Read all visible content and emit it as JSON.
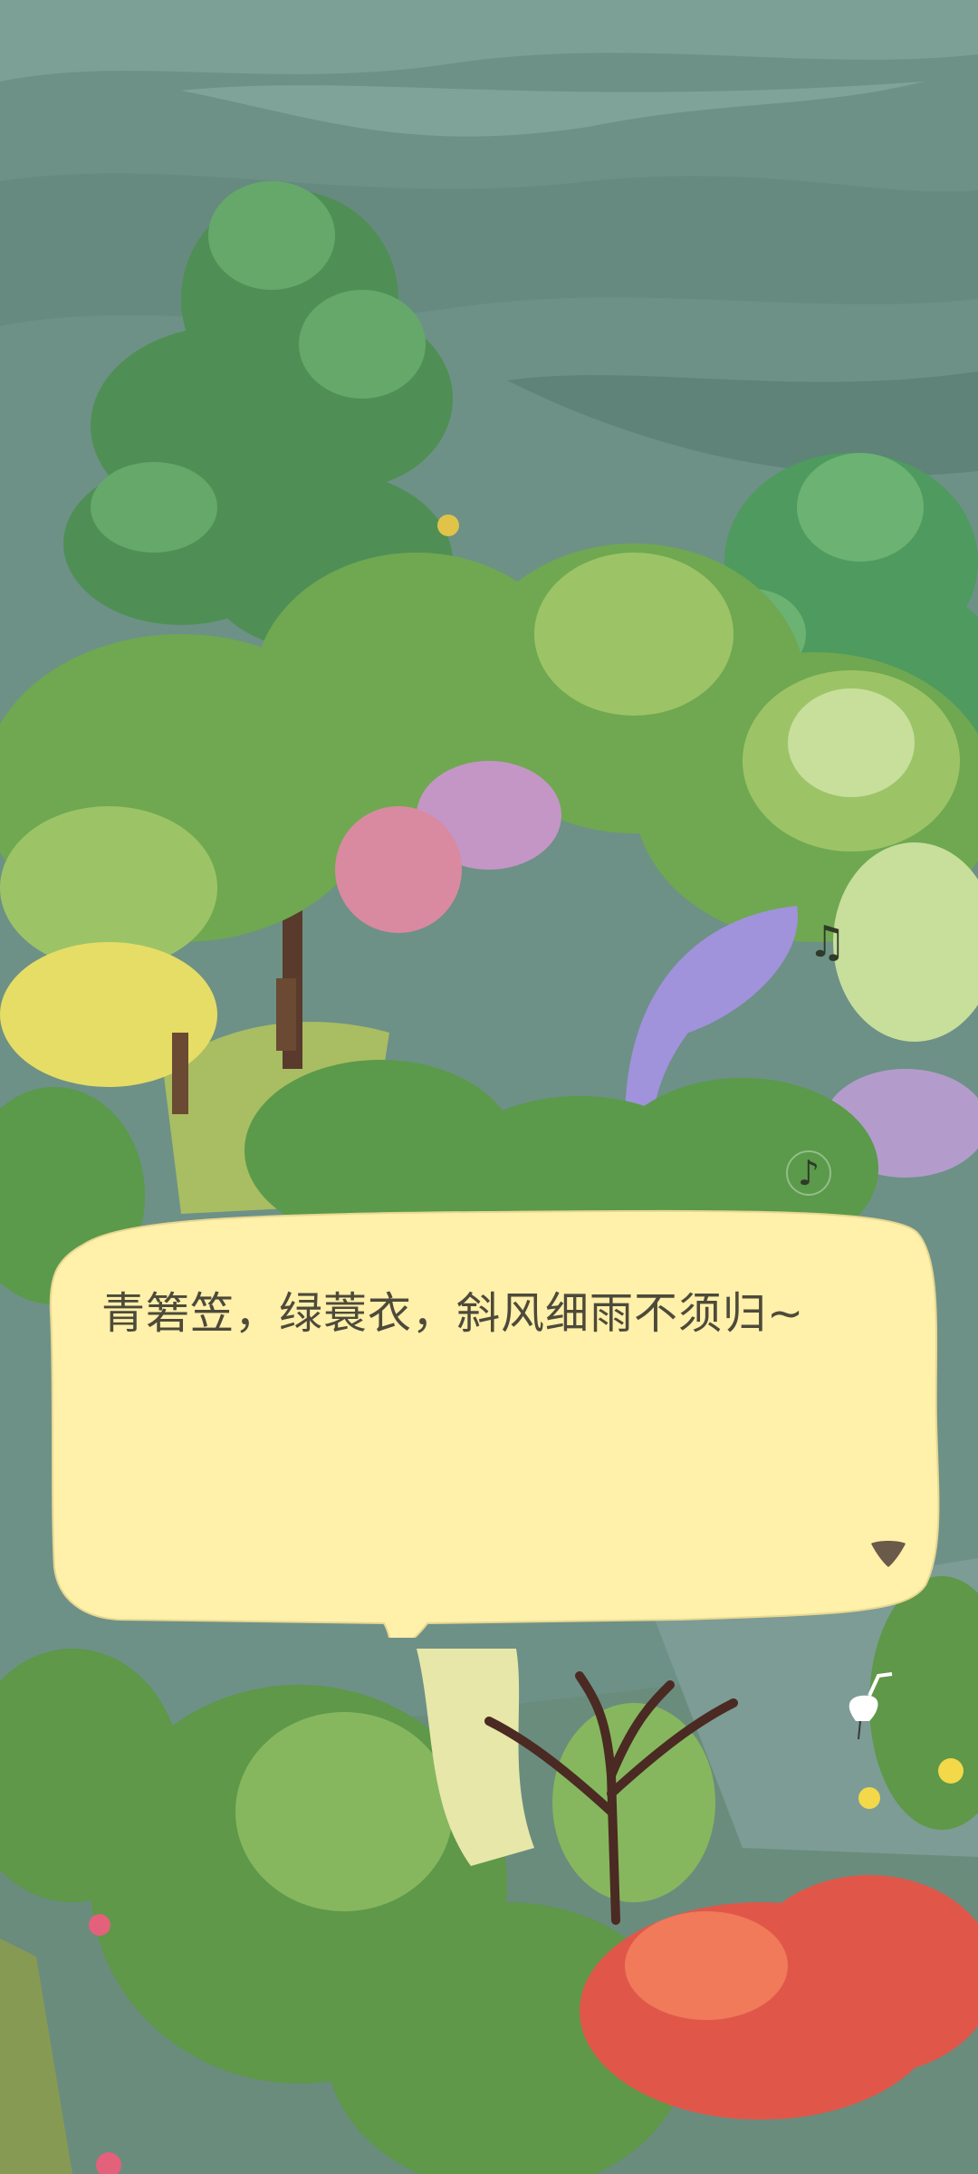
{
  "dialog": {
    "text": "青箬笠，绿蓑衣，斜风细雨不须归~",
    "continue_icon": "triangle-down-icon"
  },
  "music_notes": [
    "♫",
    "♪"
  ],
  "colors": {
    "sky": "#6f9489",
    "bubble": "#fff0aa",
    "text": "#4d4a3a"
  }
}
